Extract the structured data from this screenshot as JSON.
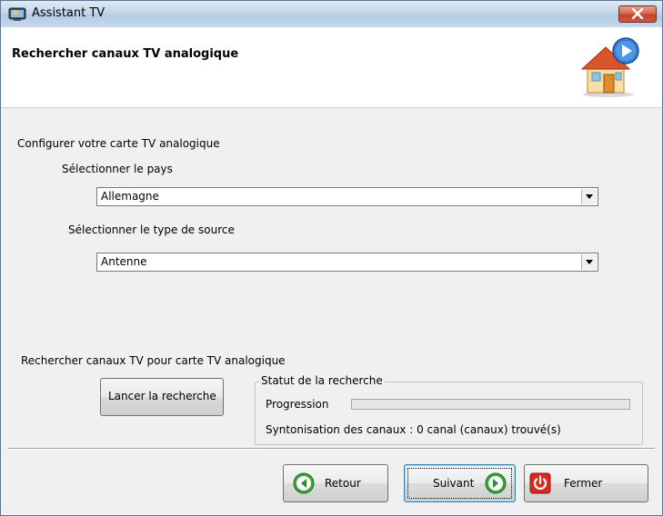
{
  "window": {
    "title": "Assistant TV",
    "close_icon": "close-icon",
    "app_icon": "tv-icon"
  },
  "header": {
    "title": "Rechercher canaux TV analogique",
    "icon": "house-play-icon"
  },
  "config": {
    "section_label": "Configurer votre carte TV analogique",
    "country_label": "Sélectionner le pays",
    "country_value": "Allemagne",
    "source_label": "Sélectionner le type de source",
    "source_value": "Antenne"
  },
  "scan": {
    "section_label": "Rechercher canaux TV pour carte TV analogique",
    "start_button": "Lancer la recherche",
    "status_group": "Statut de la recherche",
    "progress_label": "Progression",
    "progress": 0,
    "tuning_status": "Syntonisation des canaux : 0 canal (canaux) trouvé(s)"
  },
  "footer": {
    "back_label": "Retour",
    "next_label": "Suivant",
    "close_label": "Fermer"
  },
  "colors": {
    "nav_green": "#3aa53a",
    "close_red": "#d62b1e"
  }
}
